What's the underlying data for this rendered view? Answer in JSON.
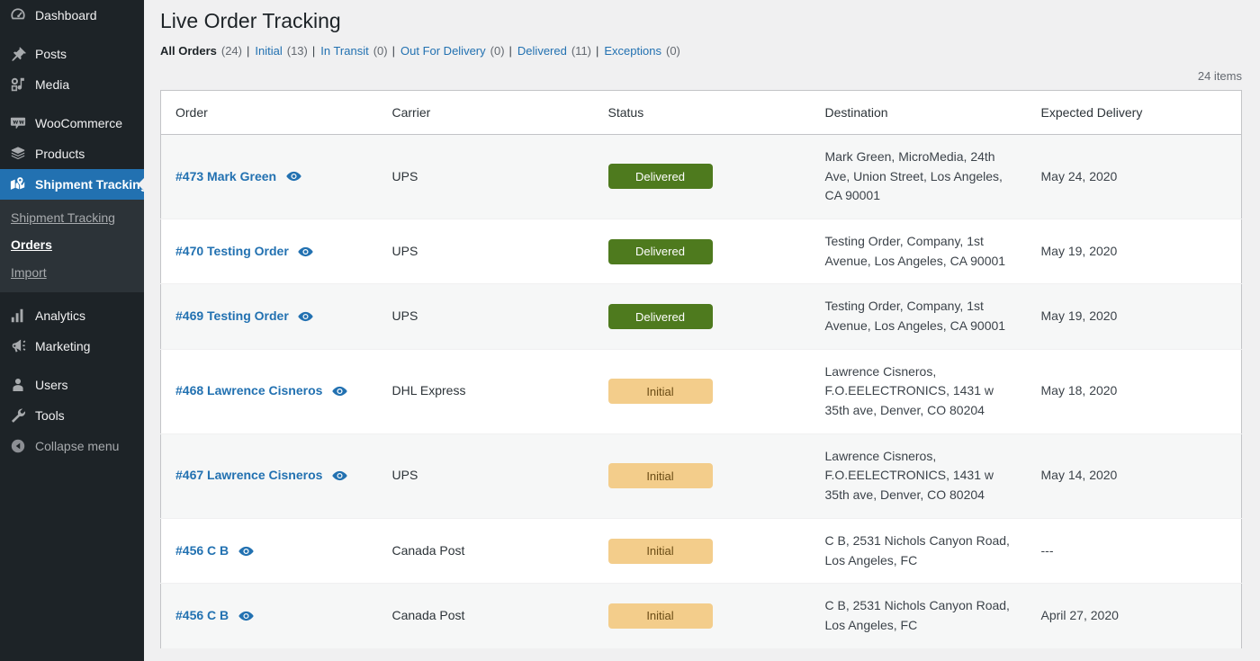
{
  "sidebar": {
    "items": [
      {
        "label": "Dashboard",
        "icon": "dashboard-icon",
        "name": "sidebar-item-dashboard",
        "dim": false
      },
      {
        "label": "Posts",
        "icon": "pin-icon",
        "name": "sidebar-item-posts",
        "dim": false
      },
      {
        "label": "Media",
        "icon": "media-icon",
        "name": "sidebar-item-media",
        "dim": false
      },
      {
        "label": "WooCommerce",
        "icon": "woocommerce-icon",
        "name": "sidebar-item-woocommerce",
        "dim": false
      },
      {
        "label": "Products",
        "icon": "products-box-icon",
        "name": "sidebar-item-products",
        "dim": false
      },
      {
        "label": "Shipment Tracking",
        "icon": "map-marker-icon",
        "name": "sidebar-item-shipment-tracking",
        "dim": false
      },
      {
        "label": "Analytics",
        "icon": "bar-chart-icon",
        "name": "sidebar-item-analytics",
        "dim": false
      },
      {
        "label": "Marketing",
        "icon": "megaphone-icon",
        "name": "sidebar-item-marketing",
        "dim": false
      },
      {
        "label": "Users",
        "icon": "user-icon",
        "name": "sidebar-item-users",
        "dim": false
      },
      {
        "label": "Tools",
        "icon": "wrench-icon",
        "name": "sidebar-item-tools",
        "dim": false
      },
      {
        "label": "Collapse menu",
        "icon": "collapse-arrow-icon",
        "name": "sidebar-item-collapse-menu",
        "dim": true
      }
    ],
    "active_item": "Shipment Tracking",
    "submenu": [
      {
        "label": "Shipment Tracking",
        "current": false
      },
      {
        "label": "Orders",
        "current": true
      },
      {
        "label": "Import",
        "current": false
      }
    ],
    "colors": {
      "background": "#1d2327",
      "submenu_background": "#2c3338",
      "active": "#2271b1"
    }
  },
  "header": {
    "title": "Live Order Tracking"
  },
  "filters": [
    {
      "label": "All Orders",
      "count": "(24)",
      "current": true
    },
    {
      "label": "Initial",
      "count": "(13)",
      "current": false
    },
    {
      "label": "In Transit",
      "count": "(0)",
      "current": false
    },
    {
      "label": "Out For Delivery",
      "count": "(0)",
      "current": false
    },
    {
      "label": "Delivered",
      "count": "(11)",
      "current": false
    },
    {
      "label": "Exceptions",
      "count": "(0)",
      "current": false
    }
  ],
  "tablenav": {
    "displaying_num": "24 items"
  },
  "table": {
    "columns": [
      "Order",
      "Carrier",
      "Status",
      "Destination",
      "Expected Delivery"
    ],
    "rows": [
      {
        "order": "#473 Mark Green",
        "carrier": "UPS",
        "status": "Delivered",
        "status_kind": "delivered",
        "destination": "Mark Green, MicroMedia, 24th Ave, Union Street, Los Angeles, CA 90001",
        "eta": "May 24, 2020"
      },
      {
        "order": "#470 Testing Order",
        "carrier": "UPS",
        "status": "Delivered",
        "status_kind": "delivered",
        "destination": "Testing Order, Company, 1st Avenue, Los Angeles, CA 90001",
        "eta": "May 19, 2020"
      },
      {
        "order": "#469 Testing Order",
        "carrier": "UPS",
        "status": "Delivered",
        "status_kind": "delivered",
        "destination": "Testing Order, Company, 1st Avenue, Los Angeles, CA 90001",
        "eta": "May 19, 2020"
      },
      {
        "order": "#468 Lawrence Cisneros",
        "carrier": "DHL Express",
        "status": "Initial",
        "status_kind": "initial",
        "destination": "Lawrence Cisneros, F.O.EELECTRONICS, 1431 w 35th ave, Denver, CO 80204",
        "eta": "May 18, 2020"
      },
      {
        "order": "#467 Lawrence Cisneros",
        "carrier": "UPS",
        "status": "Initial",
        "status_kind": "initial",
        "destination": "Lawrence Cisneros, F.O.EELECTRONICS, 1431 w 35th ave, Denver, CO 80204",
        "eta": "May 14, 2020"
      },
      {
        "order": "#456 C B",
        "carrier": "Canada Post",
        "status": "Initial",
        "status_kind": "initial",
        "destination": "C B, 2531 Nichols Canyon Road, Los Angeles, FC",
        "eta": "---"
      },
      {
        "order": "#456 C B",
        "carrier": "Canada Post",
        "status": "Initial",
        "status_kind": "initial",
        "destination": "C B, 2531 Nichols Canyon Road, Los Angeles, FC",
        "eta": "April 27, 2020"
      }
    ]
  },
  "colors": {
    "page_background": "#f0f0f1",
    "link": "#2271b1",
    "delivered_badge": "#4e7a1e",
    "initial_badge": "#f3cd8b",
    "initial_badge_text": "#6b4d16"
  }
}
